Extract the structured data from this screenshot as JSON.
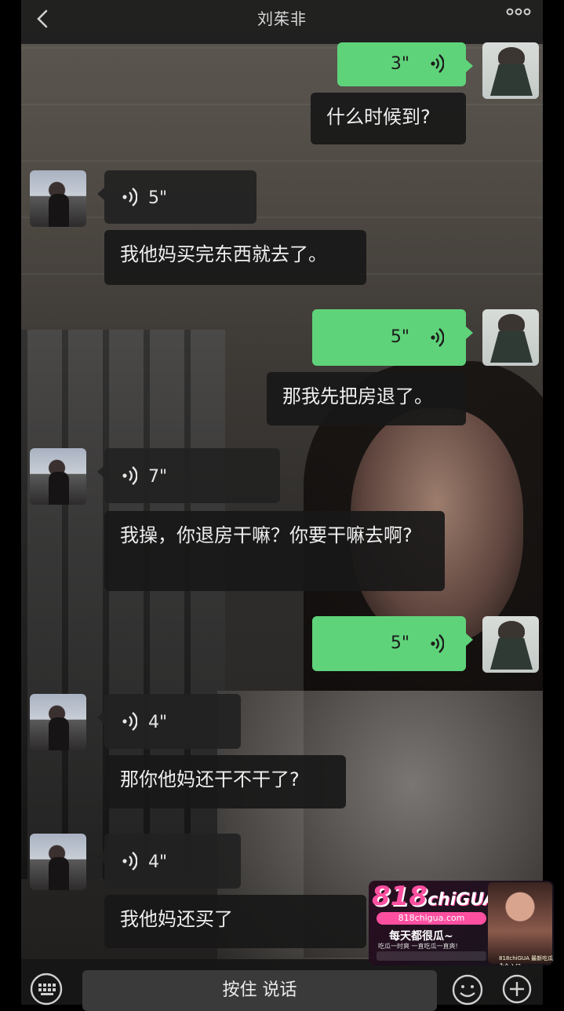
{
  "header": {
    "title": "刘茱非"
  },
  "messages": [
    {
      "side": "me",
      "type": "voice",
      "duration": "3\""
    },
    {
      "side": "me",
      "type": "transcript",
      "text": "什么时候到?"
    },
    {
      "side": "them",
      "type": "voice",
      "duration": "5\""
    },
    {
      "side": "them",
      "type": "transcript",
      "text": "我他妈买完东西就去了。"
    },
    {
      "side": "me",
      "type": "voice",
      "duration": "5\""
    },
    {
      "side": "me",
      "type": "transcript",
      "text": "那我先把房退了。"
    },
    {
      "side": "them",
      "type": "voice",
      "duration": "7\""
    },
    {
      "side": "them",
      "type": "transcript",
      "text": "我操，你退房干嘛？你要干嘛去啊?"
    },
    {
      "side": "me",
      "type": "voice",
      "duration": "5\""
    },
    {
      "side": "them",
      "type": "voice",
      "duration": "4\""
    },
    {
      "side": "them",
      "type": "transcript",
      "text": "那你他妈还干不干了?"
    },
    {
      "side": "them",
      "type": "voice",
      "duration": "4\""
    },
    {
      "side": "them",
      "type": "transcript",
      "text": "我他妈还买了"
    }
  ],
  "input_bar": {
    "hold_to_talk": "按住 说话"
  },
  "watermark": {
    "logo_number": "818",
    "logo_text": "chiGUA",
    "url": "818chigua.com",
    "slogan": "每天都很瓜~",
    "subline": "吃瓜一时爽 一直吃瓜一直爽!",
    "caption": "818chiGUA 最新吃瓜永久入口"
  },
  "colors": {
    "my_bubble": "#5fd37a",
    "their_bubble": "#222222",
    "header_bg": "#1c1c1c",
    "watermark_accent": "#ff4fa0"
  }
}
